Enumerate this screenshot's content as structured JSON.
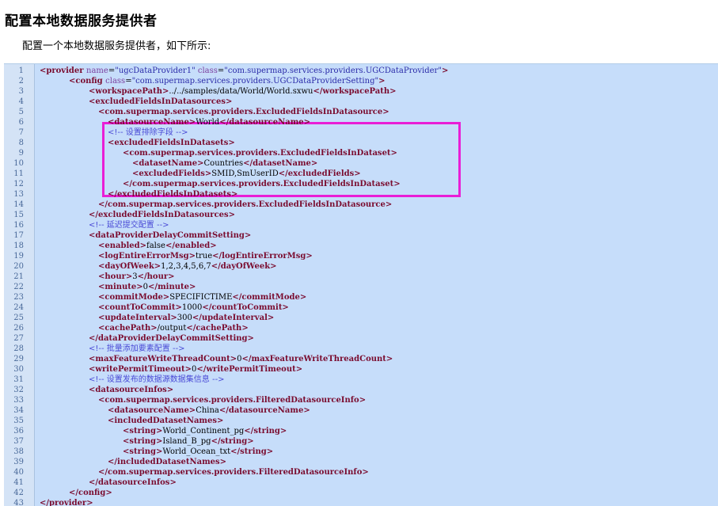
{
  "page": {
    "title": "配置本地数据服务提供者",
    "intro": "配置一个本地数据服务提供者，如下所示:"
  },
  "highlight": {
    "color": "#e91ed6",
    "first_line": 7,
    "last_line": 13
  },
  "code": [
    {
      "n": "1",
      "indent": 0,
      "parts": [
        [
          "tg",
          "<provider "
        ],
        [
          "an",
          "name"
        ],
        [
          "tx",
          "="
        ],
        [
          "av",
          "\"ugcDataProvider1\" "
        ],
        [
          "an",
          "class"
        ],
        [
          "tx",
          "="
        ],
        [
          "av",
          "\"com.supermap.services.providers.UGCDataProvider\""
        ],
        [
          "tg",
          ">"
        ]
      ]
    },
    {
      "n": "2",
      "indent": 1,
      "parts": [
        [
          "tg",
          "<config "
        ],
        [
          "an",
          "class"
        ],
        [
          "tx",
          "="
        ],
        [
          "av",
          "\"com.supermap.services.providers.UGCDataProviderSetting\""
        ],
        [
          "tg",
          ">"
        ]
      ]
    },
    {
      "n": "3",
      "indent": 2,
      "parts": [
        [
          "tg",
          "<workspacePath>"
        ],
        [
          "tx",
          "../../samples/data/World/World.sxwu"
        ],
        [
          "tg",
          "</workspacePath>"
        ]
      ]
    },
    {
      "n": "4",
      "indent": 2,
      "parts": [
        [
          "tg",
          "<excludedFieldsInDatasources>"
        ]
      ]
    },
    {
      "n": "5",
      "indent": 3,
      "parts": [
        [
          "tg",
          "<com.supermap.services.providers.ExcludedFieldsInDatasource>"
        ]
      ]
    },
    {
      "n": "6",
      "indent": 4,
      "parts": [
        [
          "tg",
          "<datasourceName>"
        ],
        [
          "tx",
          "World"
        ],
        [
          "tg",
          "</datasourceName>"
        ]
      ]
    },
    {
      "n": "7",
      "indent": 4,
      "parts": [
        [
          "cm",
          "<!-- 设置排除字段 -->"
        ]
      ]
    },
    {
      "n": "8",
      "indent": 4,
      "parts": [
        [
          "tg",
          "<excludedFieldsInDatasets>"
        ]
      ]
    },
    {
      "n": "9",
      "indent": 5,
      "parts": [
        [
          "tg",
          "<com.supermap.services.providers.ExcludedFieldsInDataset>"
        ]
      ]
    },
    {
      "n": "10",
      "indent": 6,
      "parts": [
        [
          "tg",
          "<datasetName>"
        ],
        [
          "tx",
          "Countries"
        ],
        [
          "tg",
          "</datasetName>"
        ]
      ]
    },
    {
      "n": "11",
      "indent": 6,
      "parts": [
        [
          "tg",
          "<excludedFields>"
        ],
        [
          "tx",
          "SMID,SmUserID"
        ],
        [
          "tg",
          "</excludedFields>"
        ]
      ]
    },
    {
      "n": "12",
      "indent": 5,
      "parts": [
        [
          "tg",
          "</com.supermap.services.providers.ExcludedFieldsInDataset>"
        ]
      ]
    },
    {
      "n": "13",
      "indent": 4,
      "parts": [
        [
          "tg",
          "</excludedFieldsInDatasets>"
        ]
      ]
    },
    {
      "n": "14",
      "indent": 3,
      "parts": [
        [
          "tg",
          "</com.supermap.services.providers.ExcludedFieldsInDatasource>"
        ]
      ]
    },
    {
      "n": "15",
      "indent": 2,
      "parts": [
        [
          "tg",
          "</excludedFieldsInDatasources>"
        ]
      ]
    },
    {
      "n": "16",
      "indent": 2,
      "parts": [
        [
          "cm",
          "<!-- 延迟提交配置 -->"
        ]
      ]
    },
    {
      "n": "17",
      "indent": 2,
      "parts": [
        [
          "tg",
          "<dataProviderDelayCommitSetting>"
        ]
      ]
    },
    {
      "n": "18",
      "indent": 3,
      "parts": [
        [
          "tg",
          "<enabled>"
        ],
        [
          "tx",
          "false"
        ],
        [
          "tg",
          "</enabled>"
        ]
      ]
    },
    {
      "n": "19",
      "indent": 3,
      "parts": [
        [
          "tg",
          "<logEntireErrorMsg>"
        ],
        [
          "tx",
          "true"
        ],
        [
          "tg",
          "</logEntireErrorMsg>"
        ]
      ]
    },
    {
      "n": "20",
      "indent": 3,
      "parts": [
        [
          "tg",
          "<dayOfWeek>"
        ],
        [
          "tx",
          "1,2,3,4,5,6,7"
        ],
        [
          "tg",
          "</dayOfWeek>"
        ]
      ]
    },
    {
      "n": "21",
      "indent": 3,
      "parts": [
        [
          "tg",
          "<hour>"
        ],
        [
          "tx",
          "3"
        ],
        [
          "tg",
          "</hour>"
        ]
      ]
    },
    {
      "n": "22",
      "indent": 3,
      "parts": [
        [
          "tg",
          "<minute>"
        ],
        [
          "tx",
          "0"
        ],
        [
          "tg",
          "</minute>"
        ]
      ]
    },
    {
      "n": "23",
      "indent": 3,
      "parts": [
        [
          "tg",
          "<commitMode>"
        ],
        [
          "tx",
          "SPECIFICTIME"
        ],
        [
          "tg",
          "</commitMode>"
        ]
      ]
    },
    {
      "n": "24",
      "indent": 3,
      "parts": [
        [
          "tg",
          "<countToCommit>"
        ],
        [
          "tx",
          "1000"
        ],
        [
          "tg",
          "</countToCommit>"
        ]
      ]
    },
    {
      "n": "25",
      "indent": 3,
      "parts": [
        [
          "tg",
          "<updateInterval>"
        ],
        [
          "tx",
          "300"
        ],
        [
          "tg",
          "</updateInterval>"
        ]
      ]
    },
    {
      "n": "26",
      "indent": 3,
      "parts": [
        [
          "tg",
          "<cachePath>"
        ],
        [
          "tx",
          "/output"
        ],
        [
          "tg",
          "</cachePath>"
        ]
      ]
    },
    {
      "n": "27",
      "indent": 2,
      "parts": [
        [
          "tg",
          "</dataProviderDelayCommitSetting>"
        ]
      ]
    },
    {
      "n": "28",
      "indent": 2,
      "parts": [
        [
          "cm",
          "<!-- 批量添加要素配置 -->"
        ]
      ]
    },
    {
      "n": "29",
      "indent": 2,
      "parts": [
        [
          "tg",
          "<maxFeatureWriteThreadCount>"
        ],
        [
          "tx",
          "0"
        ],
        [
          "tg",
          "</maxFeatureWriteThreadCount>"
        ]
      ]
    },
    {
      "n": "30",
      "indent": 2,
      "parts": [
        [
          "tg",
          "<writePermitTimeout>"
        ],
        [
          "tx",
          "0"
        ],
        [
          "tg",
          "</writePermitTimeout>"
        ]
      ]
    },
    {
      "n": "31",
      "indent": 2,
      "parts": [
        [
          "cm",
          "<!-- 设置发布的数据源数据集信息 -->"
        ]
      ]
    },
    {
      "n": "32",
      "indent": 2,
      "parts": [
        [
          "tg",
          "<datasourceInfos>"
        ]
      ]
    },
    {
      "n": "33",
      "indent": 3,
      "parts": [
        [
          "tg",
          "<com.supermap.services.providers.FilteredDatasourceInfo>"
        ]
      ]
    },
    {
      "n": "34",
      "indent": 4,
      "parts": [
        [
          "tg",
          "<datasourceName>"
        ],
        [
          "tx",
          "China"
        ],
        [
          "tg",
          "</datasourceName>"
        ]
      ]
    },
    {
      "n": "35",
      "indent": 4,
      "parts": [
        [
          "tg",
          "<includedDatasetNames>"
        ]
      ]
    },
    {
      "n": "36",
      "indent": 5,
      "parts": [
        [
          "tg",
          "<string>"
        ],
        [
          "tx",
          "World_Continent_pg"
        ],
        [
          "tg",
          "</string>"
        ]
      ]
    },
    {
      "n": "37",
      "indent": 5,
      "parts": [
        [
          "tg",
          "<string>"
        ],
        [
          "tx",
          "Island_B_pg"
        ],
        [
          "tg",
          "</string>"
        ]
      ]
    },
    {
      "n": "38",
      "indent": 5,
      "parts": [
        [
          "tg",
          "<string>"
        ],
        [
          "tx",
          "World_Ocean_txt"
        ],
        [
          "tg",
          "</string>"
        ]
      ]
    },
    {
      "n": "39",
      "indent": 4,
      "parts": [
        [
          "tg",
          "</includedDatasetNames>"
        ]
      ]
    },
    {
      "n": "40",
      "indent": 3,
      "parts": [
        [
          "tg",
          "</com.supermap.services.providers.FilteredDatasourceInfo>"
        ]
      ]
    },
    {
      "n": "41",
      "indent": 2,
      "parts": [
        [
          "tg",
          "</datasourceInfos>"
        ]
      ]
    },
    {
      "n": "42",
      "indent": 1,
      "parts": [
        [
          "tg",
          "</config>"
        ]
      ]
    },
    {
      "n": "43",
      "indent": 0,
      "parts": [
        [
          "tg",
          "</provider>"
        ]
      ]
    }
  ]
}
